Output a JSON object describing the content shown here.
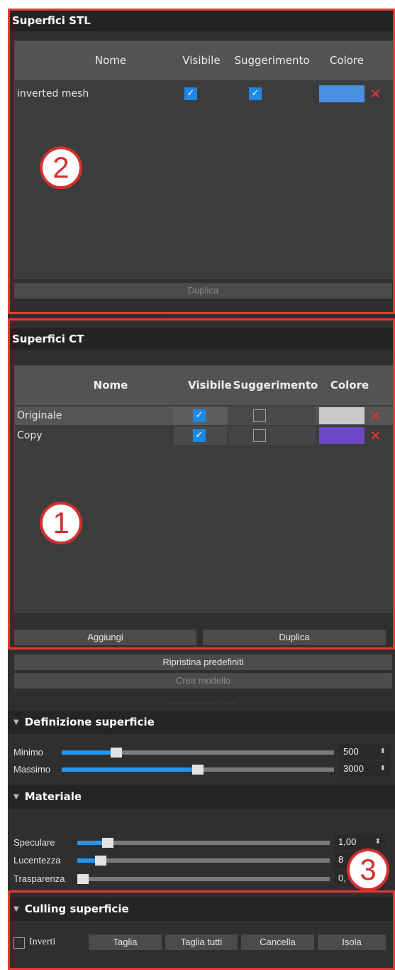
{
  "stl": {
    "title": "Superfici STL",
    "columns": [
      "Nome",
      "Visibile",
      "Suggerimento",
      "Colore"
    ],
    "rows": [
      {
        "name": "inverted mesh",
        "visible": true,
        "hint": true,
        "color": "#4a90e2"
      }
    ],
    "duplicate": "Duplica"
  },
  "ct": {
    "title": "Superfici CT",
    "columns": [
      "Nome",
      "Visibile",
      "Suggerimento",
      "Colore"
    ],
    "rows": [
      {
        "name": "Originale",
        "visible": true,
        "hint": false,
        "color": "#c8c8c8"
      },
      {
        "name": "Copy",
        "visible": true,
        "hint": false,
        "color": "#6a48c8"
      }
    ],
    "add": "Aggiungi",
    "duplicate": "Duplica"
  },
  "reset": "Ripristina predefiniti",
  "create_model": "Crea modello",
  "surface_def": {
    "title": "Definizione superficie",
    "min": {
      "label": "Minimo",
      "value": "500",
      "fraction": 0.2
    },
    "max": {
      "label": "Massimo",
      "value": "3000",
      "fraction": 0.51
    }
  },
  "material": {
    "title": "Materiale",
    "specular": {
      "label": "Speculare",
      "value": "1,00",
      "fraction": 0.12
    },
    "shininess": {
      "label": "Lucentezza",
      "value": "8",
      "fraction": 0.09
    },
    "transparency": {
      "label": "Trasparenza",
      "value": "0,",
      "fraction": 0.0
    }
  },
  "culling": {
    "title": "Culling superficie",
    "invert": "Inverti",
    "cut": "Taglia",
    "cut_all": "Taglia tutti",
    "delete": "Cancella",
    "isolate": "Isola"
  },
  "callouts": [
    "2",
    "1",
    "3"
  ],
  "icons": {
    "section_arrow": "triangle-down-icon",
    "delete": "close-icon",
    "check": "checkmark-icon",
    "spin": "spin-arrows-icon"
  },
  "colors": {
    "accent": "#2196f3",
    "annotation": "#e53935"
  }
}
